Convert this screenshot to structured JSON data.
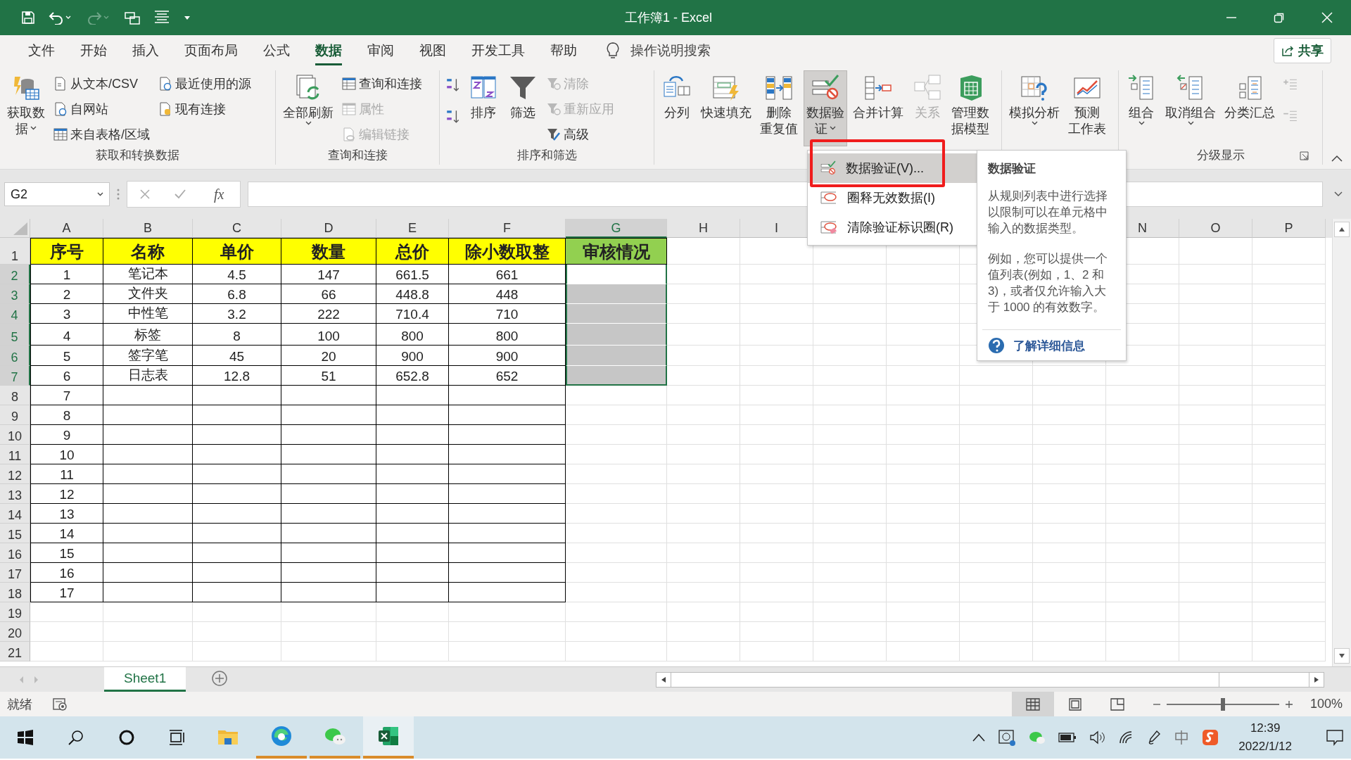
{
  "window": {
    "title": "工作簿1  -  Excel"
  },
  "ribbon_tabs": [
    {
      "label": "文件",
      "selected": false
    },
    {
      "label": "开始",
      "selected": false
    },
    {
      "label": "插入",
      "selected": false
    },
    {
      "label": "页面布局",
      "selected": false
    },
    {
      "label": "公式",
      "selected": false
    },
    {
      "label": "数据",
      "selected": true
    },
    {
      "label": "审阅",
      "selected": false
    },
    {
      "label": "视图",
      "selected": false
    },
    {
      "label": "开发工具",
      "selected": false
    },
    {
      "label": "帮助",
      "selected": false
    }
  ],
  "tell_me": {
    "placeholder": "操作说明搜索"
  },
  "share_button": {
    "label": "共享"
  },
  "ribbon": {
    "groups": [
      {
        "label": "获取和转换数据",
        "items": [
          {
            "kind": "large",
            "label_lines": [
              "获取数",
              "据"
            ],
            "dropdown": true,
            "pressed": false,
            "disabled": false
          },
          {
            "kind": "stack",
            "entries": [
              {
                "label": "从文本/CSV",
                "disabled": false
              },
              {
                "label": "自网站",
                "disabled": false
              },
              {
                "label": "来自表格/区域",
                "disabled": false
              }
            ]
          },
          {
            "kind": "stack",
            "entries": [
              {
                "label": "最近使用的源",
                "disabled": false
              },
              {
                "label": "现有连接",
                "disabled": false
              }
            ]
          }
        ]
      },
      {
        "label": "查询和连接",
        "items": [
          {
            "kind": "large",
            "label_lines": [
              "全部刷新"
            ],
            "dropdown": true,
            "pressed": false,
            "disabled": false
          },
          {
            "kind": "stack",
            "entries": [
              {
                "label": "查询和连接",
                "disabled": false
              },
              {
                "label": "属性",
                "disabled": true
              },
              {
                "label": "编辑链接",
                "disabled": true
              }
            ]
          }
        ]
      },
      {
        "label": "排序和筛选",
        "items": [
          {
            "kind": "icon-stack",
            "entries": [
              {
                "disabled": false
              },
              {
                "disabled": false
              }
            ]
          },
          {
            "kind": "large",
            "label_lines": [
              "排序"
            ],
            "dropdown": false,
            "pressed": false,
            "disabled": false
          },
          {
            "kind": "large",
            "label_lines": [
              "筛选"
            ],
            "dropdown": false,
            "pressed": false,
            "disabled": false
          },
          {
            "kind": "stack",
            "entries": [
              {
                "label": "清除",
                "disabled": true
              },
              {
                "label": "重新应用",
                "disabled": true
              },
              {
                "label": "高级",
                "disabled": false
              }
            ]
          }
        ]
      },
      {
        "items": [
          {
            "kind": "large",
            "label_lines": [
              "分列"
            ],
            "dropdown": false,
            "pressed": false,
            "disabled": false
          },
          {
            "kind": "large",
            "label_lines": [
              "快速填充"
            ],
            "dropdown": false,
            "pressed": false,
            "disabled": false
          },
          {
            "kind": "large",
            "label_lines": [
              "删除",
              "重复值"
            ],
            "dropdown": false,
            "pressed": false,
            "disabled": false
          },
          {
            "kind": "large",
            "label_lines": [
              "数据验",
              "证"
            ],
            "dropdown": true,
            "pressed": true,
            "disabled": false
          },
          {
            "kind": "large",
            "label_lines": [
              "合并计算"
            ],
            "dropdown": false,
            "pressed": false,
            "disabled": false
          },
          {
            "kind": "large",
            "label_lines": [
              "关系"
            ],
            "dropdown": false,
            "pressed": false,
            "disabled": true
          },
          {
            "kind": "large",
            "label_lines": [
              "管理数",
              "据模型"
            ],
            "dropdown": false,
            "pressed": false,
            "disabled": false
          }
        ]
      },
      {
        "items": [
          {
            "kind": "large",
            "label_lines": [
              "模拟分析"
            ],
            "dropdown": true,
            "pressed": false,
            "disabled": false
          },
          {
            "kind": "large",
            "label_lines": [
              "预测",
              "工作表"
            ],
            "dropdown": false,
            "pressed": false,
            "disabled": false
          }
        ]
      },
      {
        "label": "分级显示",
        "items": [
          {
            "kind": "large",
            "label_lines": [
              "组合"
            ],
            "dropdown": true,
            "pressed": false,
            "disabled": false
          },
          {
            "kind": "large",
            "label_lines": [
              "取消组合"
            ],
            "dropdown": true,
            "pressed": false,
            "disabled": false
          },
          {
            "kind": "large",
            "label_lines": [
              "分类汇总"
            ],
            "dropdown": false,
            "pressed": false,
            "disabled": false
          },
          {
            "kind": "icon-stack",
            "entries": [
              {
                "disabled": true
              },
              {
                "disabled": true
              }
            ]
          }
        ]
      }
    ]
  },
  "formula_bar": {
    "name_box": "G2",
    "function_label": "fx"
  },
  "sheet": {
    "columns": [
      {
        "letter": "A",
        "selected": false
      },
      {
        "letter": "B",
        "selected": false
      },
      {
        "letter": "C",
        "selected": false
      },
      {
        "letter": "D",
        "selected": false
      },
      {
        "letter": "E",
        "selected": false
      },
      {
        "letter": "F",
        "selected": false
      },
      {
        "letter": "G",
        "selected": true
      },
      {
        "letter": "H",
        "selected": false
      },
      {
        "letter": "I",
        "selected": false
      }
    ],
    "columns_right": [
      {
        "letter": "N",
        "selected": false
      },
      {
        "letter": "O",
        "selected": false
      },
      {
        "letter": "P",
        "selected": false
      }
    ],
    "header_row": {
      "number": "1",
      "selected": false,
      "cells": [
        {
          "text": "序号",
          "color": "#ffff00"
        },
        {
          "text": "名称",
          "color": "#ffff00"
        },
        {
          "text": "单价",
          "color": "#ffff00"
        },
        {
          "text": "数量",
          "color": "#ffff00"
        },
        {
          "text": "总价",
          "color": "#ffff00"
        },
        {
          "text": "除小数取整",
          "color": "#ffff00"
        },
        {
          "text": "审核情况",
          "color": "#92d050"
        }
      ]
    },
    "rows": [
      {
        "number": "2",
        "selected": true,
        "cells": [
          "1",
          "笔记本",
          "4.5",
          "147",
          "661.5",
          "661",
          ""
        ]
      },
      {
        "number": "3",
        "selected": true,
        "cells": [
          "2",
          "文件夹",
          "6.8",
          "66",
          "448.8",
          "448",
          ""
        ]
      },
      {
        "number": "4",
        "selected": true,
        "cells": [
          "3",
          "中性笔",
          "3.2",
          "222",
          "710.4",
          "710",
          ""
        ]
      },
      {
        "number": "5",
        "selected": true,
        "cells": [
          "4",
          "标签",
          "8",
          "100",
          "800",
          "800",
          ""
        ]
      },
      {
        "number": "6",
        "selected": true,
        "cells": [
          "5",
          "签字笔",
          "45",
          "20",
          "900",
          "900",
          ""
        ]
      },
      {
        "number": "7",
        "selected": true,
        "cells": [
          "6",
          "日志表",
          "12.8",
          "51",
          "652.8",
          "652",
          ""
        ]
      },
      {
        "number": "8",
        "selected": false,
        "cells": [
          "7"
        ]
      },
      {
        "number": "9",
        "selected": false,
        "cells": [
          "8"
        ]
      },
      {
        "number": "10",
        "selected": false,
        "cells": [
          "9"
        ]
      },
      {
        "number": "11",
        "selected": false,
        "cells": [
          "10"
        ]
      },
      {
        "number": "12",
        "selected": false,
        "cells": [
          "11"
        ]
      },
      {
        "number": "13",
        "selected": false,
        "cells": [
          "12"
        ]
      },
      {
        "number": "14",
        "selected": false,
        "cells": [
          "13"
        ]
      },
      {
        "number": "15",
        "selected": false,
        "cells": [
          "14"
        ]
      },
      {
        "number": "16",
        "selected": false,
        "cells": [
          "15"
        ]
      },
      {
        "number": "17",
        "selected": false,
        "cells": [
          "16"
        ]
      },
      {
        "number": "18",
        "selected": false,
        "cells": [
          "17"
        ]
      },
      {
        "number": "19",
        "selected": false
      },
      {
        "number": "20",
        "selected": false
      },
      {
        "number": "21",
        "selected": false
      }
    ]
  },
  "dropdown_menu": {
    "items": [
      {
        "label": "数据验证(V)...",
        "selected": true
      },
      {
        "label": "圈释无效数据(I)",
        "selected": false
      },
      {
        "label": "清除验证标识圈(R)",
        "selected": false
      }
    ]
  },
  "tooltip": {
    "title": "数据验证",
    "paragraphs": [
      "从规则列表中进行选择以限制可以在单元格中输入的数据类型。",
      "例如，您可以提供一个值列表(例如，1、2 和 3)，或者仅允许输入大于 1000 的有效数字。"
    ],
    "link": "了解详细信息"
  },
  "sheet_tabs": [
    {
      "label": "Sheet1",
      "selected": true
    }
  ],
  "status_bar": {
    "status": "就绪",
    "views": [
      {
        "selected": true
      },
      {
        "selected": false
      },
      {
        "selected": false
      }
    ],
    "zoom": {
      "level": 0.5,
      "reading": "100%"
    }
  },
  "taskbar": {
    "apps": [
      {
        "running": false,
        "active": false
      },
      {
        "running": true,
        "active": false
      },
      {
        "running": true,
        "active": false
      },
      {
        "running": true,
        "active": true
      }
    ],
    "time": "12:39",
    "date": "2022/1/12"
  }
}
